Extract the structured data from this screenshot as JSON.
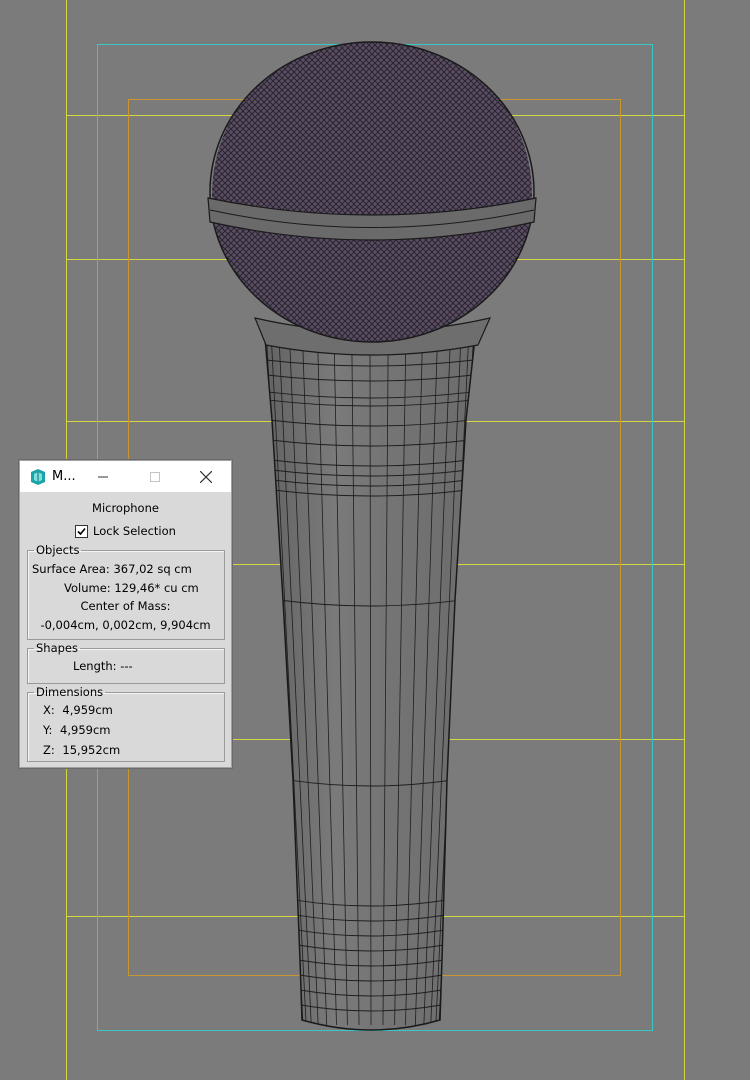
{
  "dialog": {
    "title": "M...",
    "object_name": "Microphone",
    "lock_selection_label": "Lock Selection",
    "lock_selection_checked": true,
    "objects": {
      "legend": "Objects",
      "surface_area_label": "Surface Area:",
      "surface_area_value": "367,02 sq cm",
      "volume_label": "Volume:",
      "volume_value": "129,46* cu cm",
      "center_of_mass_label": "Center of Mass:",
      "center_of_mass_value": "-0,004cm, 0,002cm, 9,904cm"
    },
    "shapes": {
      "legend": "Shapes",
      "length_label": "Length:",
      "length_value": "---"
    },
    "dimensions": {
      "legend": "Dimensions",
      "x_label": "X:",
      "x_value": "4,959cm",
      "y_label": "Y:",
      "y_value": "4,959cm",
      "z_label": "Z:",
      "z_value": "15,952cm"
    }
  },
  "colors": {
    "viewport_bg": "#7b7b7b",
    "grid_yellow": "#d6d640",
    "frame_cyan": "#39c6c6",
    "frame_orange": "#c89630",
    "wire": "#1e1e1e",
    "mesh_grille": "#4a4252"
  }
}
